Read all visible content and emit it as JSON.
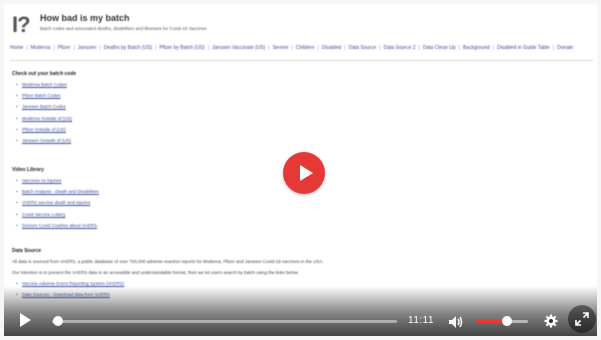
{
  "header": {
    "logo_text": "I?",
    "title": "How bad is my batch",
    "subtitle": "Batch codes and associated deaths, disabilities and illnesses for Covid-19 Vaccines"
  },
  "nav": [
    "Home",
    "Moderna",
    "Pfizer",
    "Janssen",
    "Deaths by Batch (US)",
    "Pfizer by Batch (US)",
    "Janssen Vaccinate (US)",
    "Severe",
    "Children",
    "Disabled",
    "Data Source",
    "Data Source 2",
    "Data Clean Up",
    "Background",
    "Disabled in Guide Table",
    "Donate"
  ],
  "sections": {
    "check": {
      "heading": "Check out your batch code",
      "links": [
        "Moderna Batch Codes",
        "Pfizer Batch Codes",
        "Janssen Batch Codes",
        "Moderna Outside of (US)",
        "Pfizer Outside of (US)",
        "Janssen Outside of (US)"
      ]
    },
    "videos": {
      "heading": "Video Library",
      "links": [
        "Vaccines vs Injuries",
        "Batch Analysis - Death and Disabilities",
        "VAERS vaccine death and injuries",
        "Covid Vaccine Lottery",
        "Doctors Covid Crashes about VAERS"
      ]
    },
    "data": {
      "heading": "Data Source",
      "para1": "All data is sourced from VAERS, a public database of over 700,000 adverse reaction reports for Moderna, Pfizer and Janssen Covid-19 vaccines in the USA.",
      "para2": "Our intention is to present the VAERS data in an accessible and understandable format, then we let users search by batch using the links below.",
      "links": [
        "Vaccine Adverse Event Reporting System (VAERS)",
        "Data Sources - Download data from VAERS"
      ]
    }
  },
  "player": {
    "time": "11:11",
    "progress": 0.01,
    "volume": 0.6,
    "accent_color": "#e53935",
    "play_icon": "play-icon",
    "volume_icon": "volume-icon",
    "settings_icon": "gear-icon",
    "fullscreen_icon": "fullscreen-icon"
  }
}
